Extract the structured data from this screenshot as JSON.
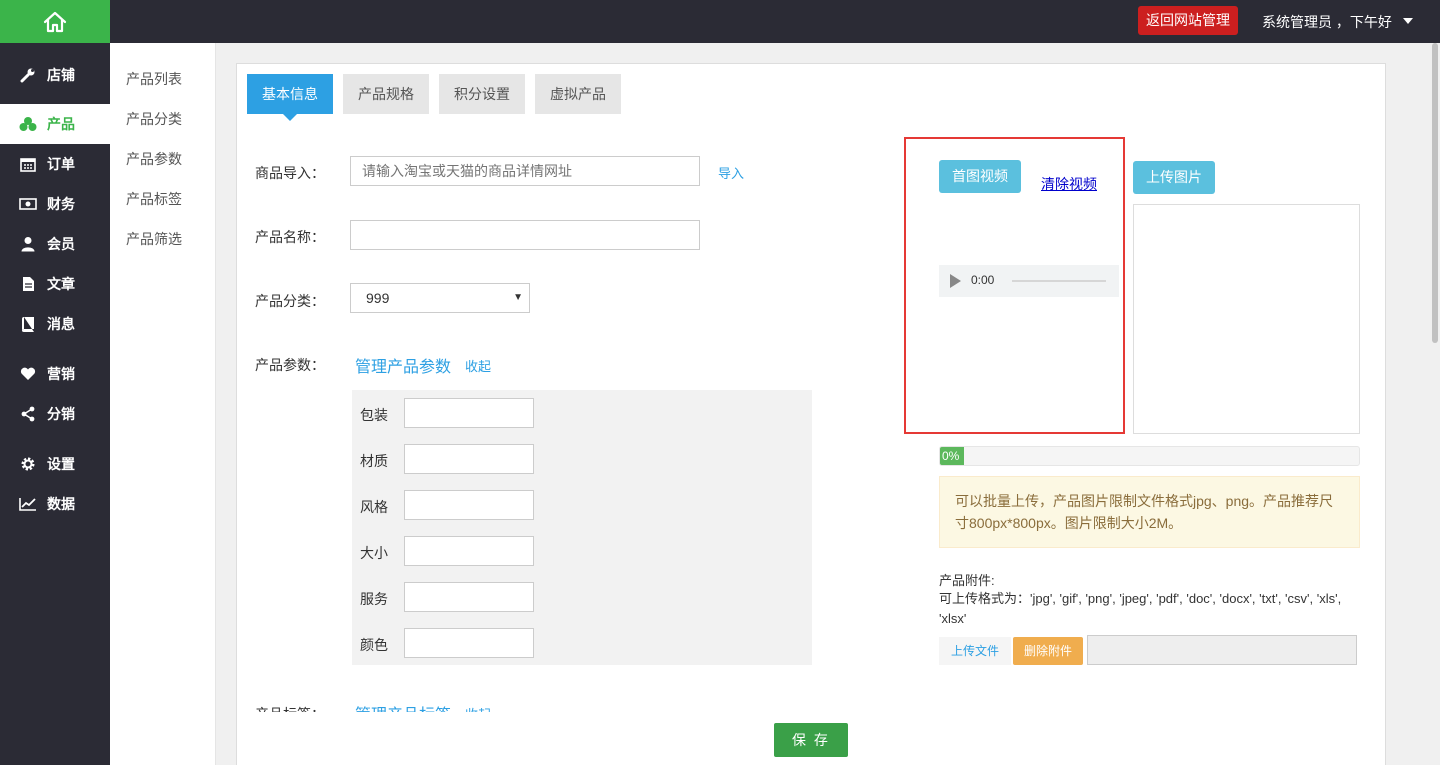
{
  "header": {
    "back_button": "返回网站管理",
    "user_greeting": "系统管理员 ，下午好"
  },
  "sidebar": {
    "items": [
      {
        "label": "店铺",
        "icon": "wrench-icon"
      },
      {
        "label": "产品",
        "icon": "cubes-icon",
        "active": true
      },
      {
        "label": "订单",
        "icon": "calendar-icon"
      },
      {
        "label": "财务",
        "icon": "money-icon"
      },
      {
        "label": "会员",
        "icon": "user-icon"
      },
      {
        "label": "文章",
        "icon": "file-icon"
      },
      {
        "label": "消息",
        "icon": "book-icon"
      },
      {
        "label": "营销",
        "icon": "heart-icon"
      },
      {
        "label": "分销",
        "icon": "share-icon"
      },
      {
        "label": "设置",
        "icon": "gear-icon"
      },
      {
        "label": "数据",
        "icon": "chart-icon"
      }
    ]
  },
  "subnav": {
    "items": [
      "产品列表",
      "产品分类",
      "产品参数",
      "产品标签",
      "产品筛选"
    ]
  },
  "tabs": [
    "基本信息",
    "产品规格",
    "积分设置",
    "虚拟产品"
  ],
  "form": {
    "import_label": "商品导入：",
    "import_placeholder": "请输入淘宝或天猫的商品详情网址",
    "import_button": "导入",
    "name_label": "产品名称：",
    "name_value": "",
    "category_label": "产品分类：",
    "category_value": "999",
    "params_label": "产品参数：",
    "manage_params": "管理产品参数",
    "collapse": "收起",
    "params": [
      "包装",
      "材质",
      "风格",
      "大小",
      "服务",
      "颜色"
    ],
    "tags_label": "产品标签：",
    "manage_tags": "管理产品标签",
    "save_button": "保 存"
  },
  "media": {
    "video_button": "首图视频",
    "clear_video": "清除视频",
    "upload_image": "上传图片",
    "audio_time": "0:00",
    "progress_percent": 0,
    "progress_label": "0%",
    "notice": "可以批量上传，产品图片限制文件格式jpg、png。产品推荐尺寸800px*800px。图片限制大小2M。",
    "attachment_title": "产品附件:",
    "attachment_formats": "可上传格式为：'jpg', 'gif', 'png', 'jpeg', 'pdf', 'doc', 'docx', 'txt', 'csv', 'xls', 'xlsx'",
    "upload_file": "上传文件",
    "delete_file": "删除附件"
  },
  "colors": {
    "brand_green": "#3bb44a",
    "sidebar_dark": "#2b2b35",
    "tab_blue": "#2da0e3",
    "highlight_red": "#e53935"
  }
}
